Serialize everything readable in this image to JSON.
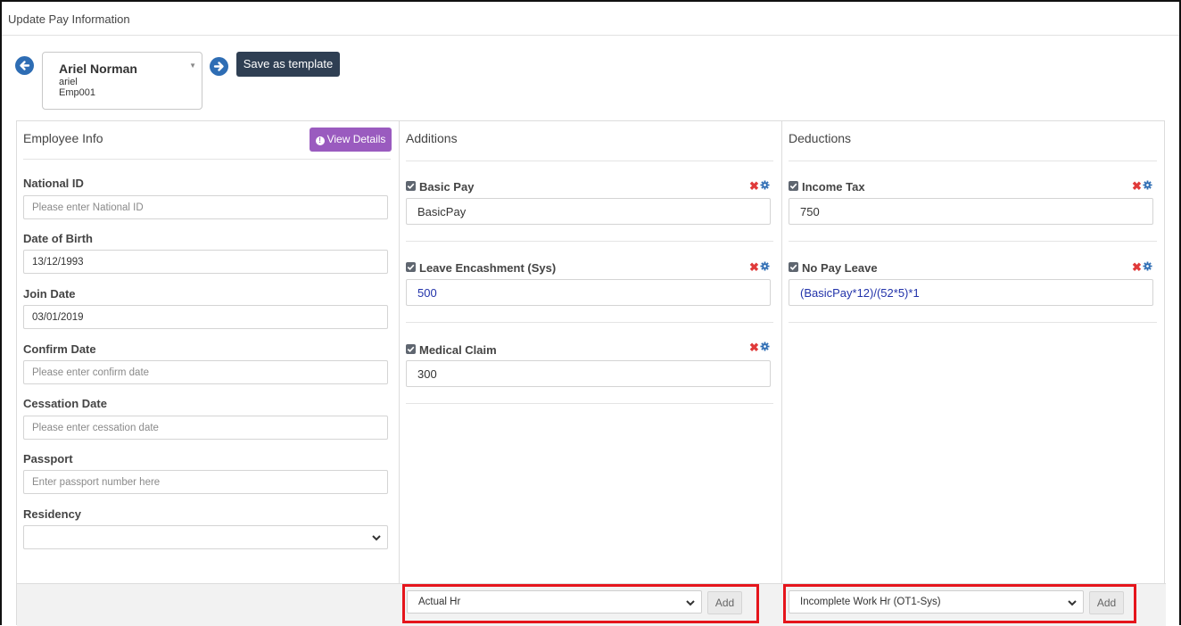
{
  "window": {
    "title": "Update Pay Information"
  },
  "employee": {
    "name": "Ariel Norman",
    "username": "ariel",
    "code": "Emp001"
  },
  "toolbar": {
    "save_template_label": "Save as template"
  },
  "info": {
    "title": "Employee Info",
    "view_details_label": "View Details",
    "fields": {
      "national_id": {
        "label": "National ID",
        "placeholder": "Please enter National ID",
        "value": ""
      },
      "dob": {
        "label": "Date of Birth",
        "value": "13/12/1993"
      },
      "join_date": {
        "label": "Join Date",
        "value": "03/01/2019"
      },
      "confirm_date": {
        "label": "Confirm Date",
        "placeholder": "Please enter confirm date",
        "value": ""
      },
      "cessation_date": {
        "label": "Cessation Date",
        "placeholder": "Please enter cessation date",
        "value": ""
      },
      "passport": {
        "label": "Passport",
        "placeholder": "Enter passport number here",
        "value": ""
      },
      "residency": {
        "label": "Residency",
        "value": ""
      }
    }
  },
  "additions": {
    "title": "Additions",
    "items": [
      {
        "label": "Basic Pay",
        "value": "BasicPay",
        "checked": true
      },
      {
        "label": "Leave Encashment (Sys)",
        "value": "500",
        "checked": true
      },
      {
        "label": "Medical Claim",
        "value": "300",
        "checked": true
      }
    ],
    "footer": {
      "selected": "Actual Hr",
      "add_label": "Add"
    }
  },
  "deductions": {
    "title": "Deductions",
    "items": [
      {
        "label": "Income Tax",
        "value": "750",
        "checked": true
      },
      {
        "label": "No Pay Leave",
        "value": "(BasicPay*12)/(52*5)*1",
        "checked": true
      }
    ],
    "footer": {
      "selected": "Incomplete Work Hr (OT1-Sys)",
      "add_label": "Add"
    }
  },
  "colors": {
    "primary_blue": "#2e6db4",
    "dark_button": "#2f3f53",
    "purple_button": "#9a5bbf",
    "remove_red": "#e03a3a",
    "highlight_red": "#e5151c",
    "formula_blue": "#2233aa"
  },
  "icons": {
    "prev": "arrow-left-circle-icon",
    "next": "arrow-right-circle-icon",
    "remove": "close-icon",
    "settings": "gear-icon",
    "info": "info-icon",
    "dropdown": "chevron-down-icon"
  }
}
